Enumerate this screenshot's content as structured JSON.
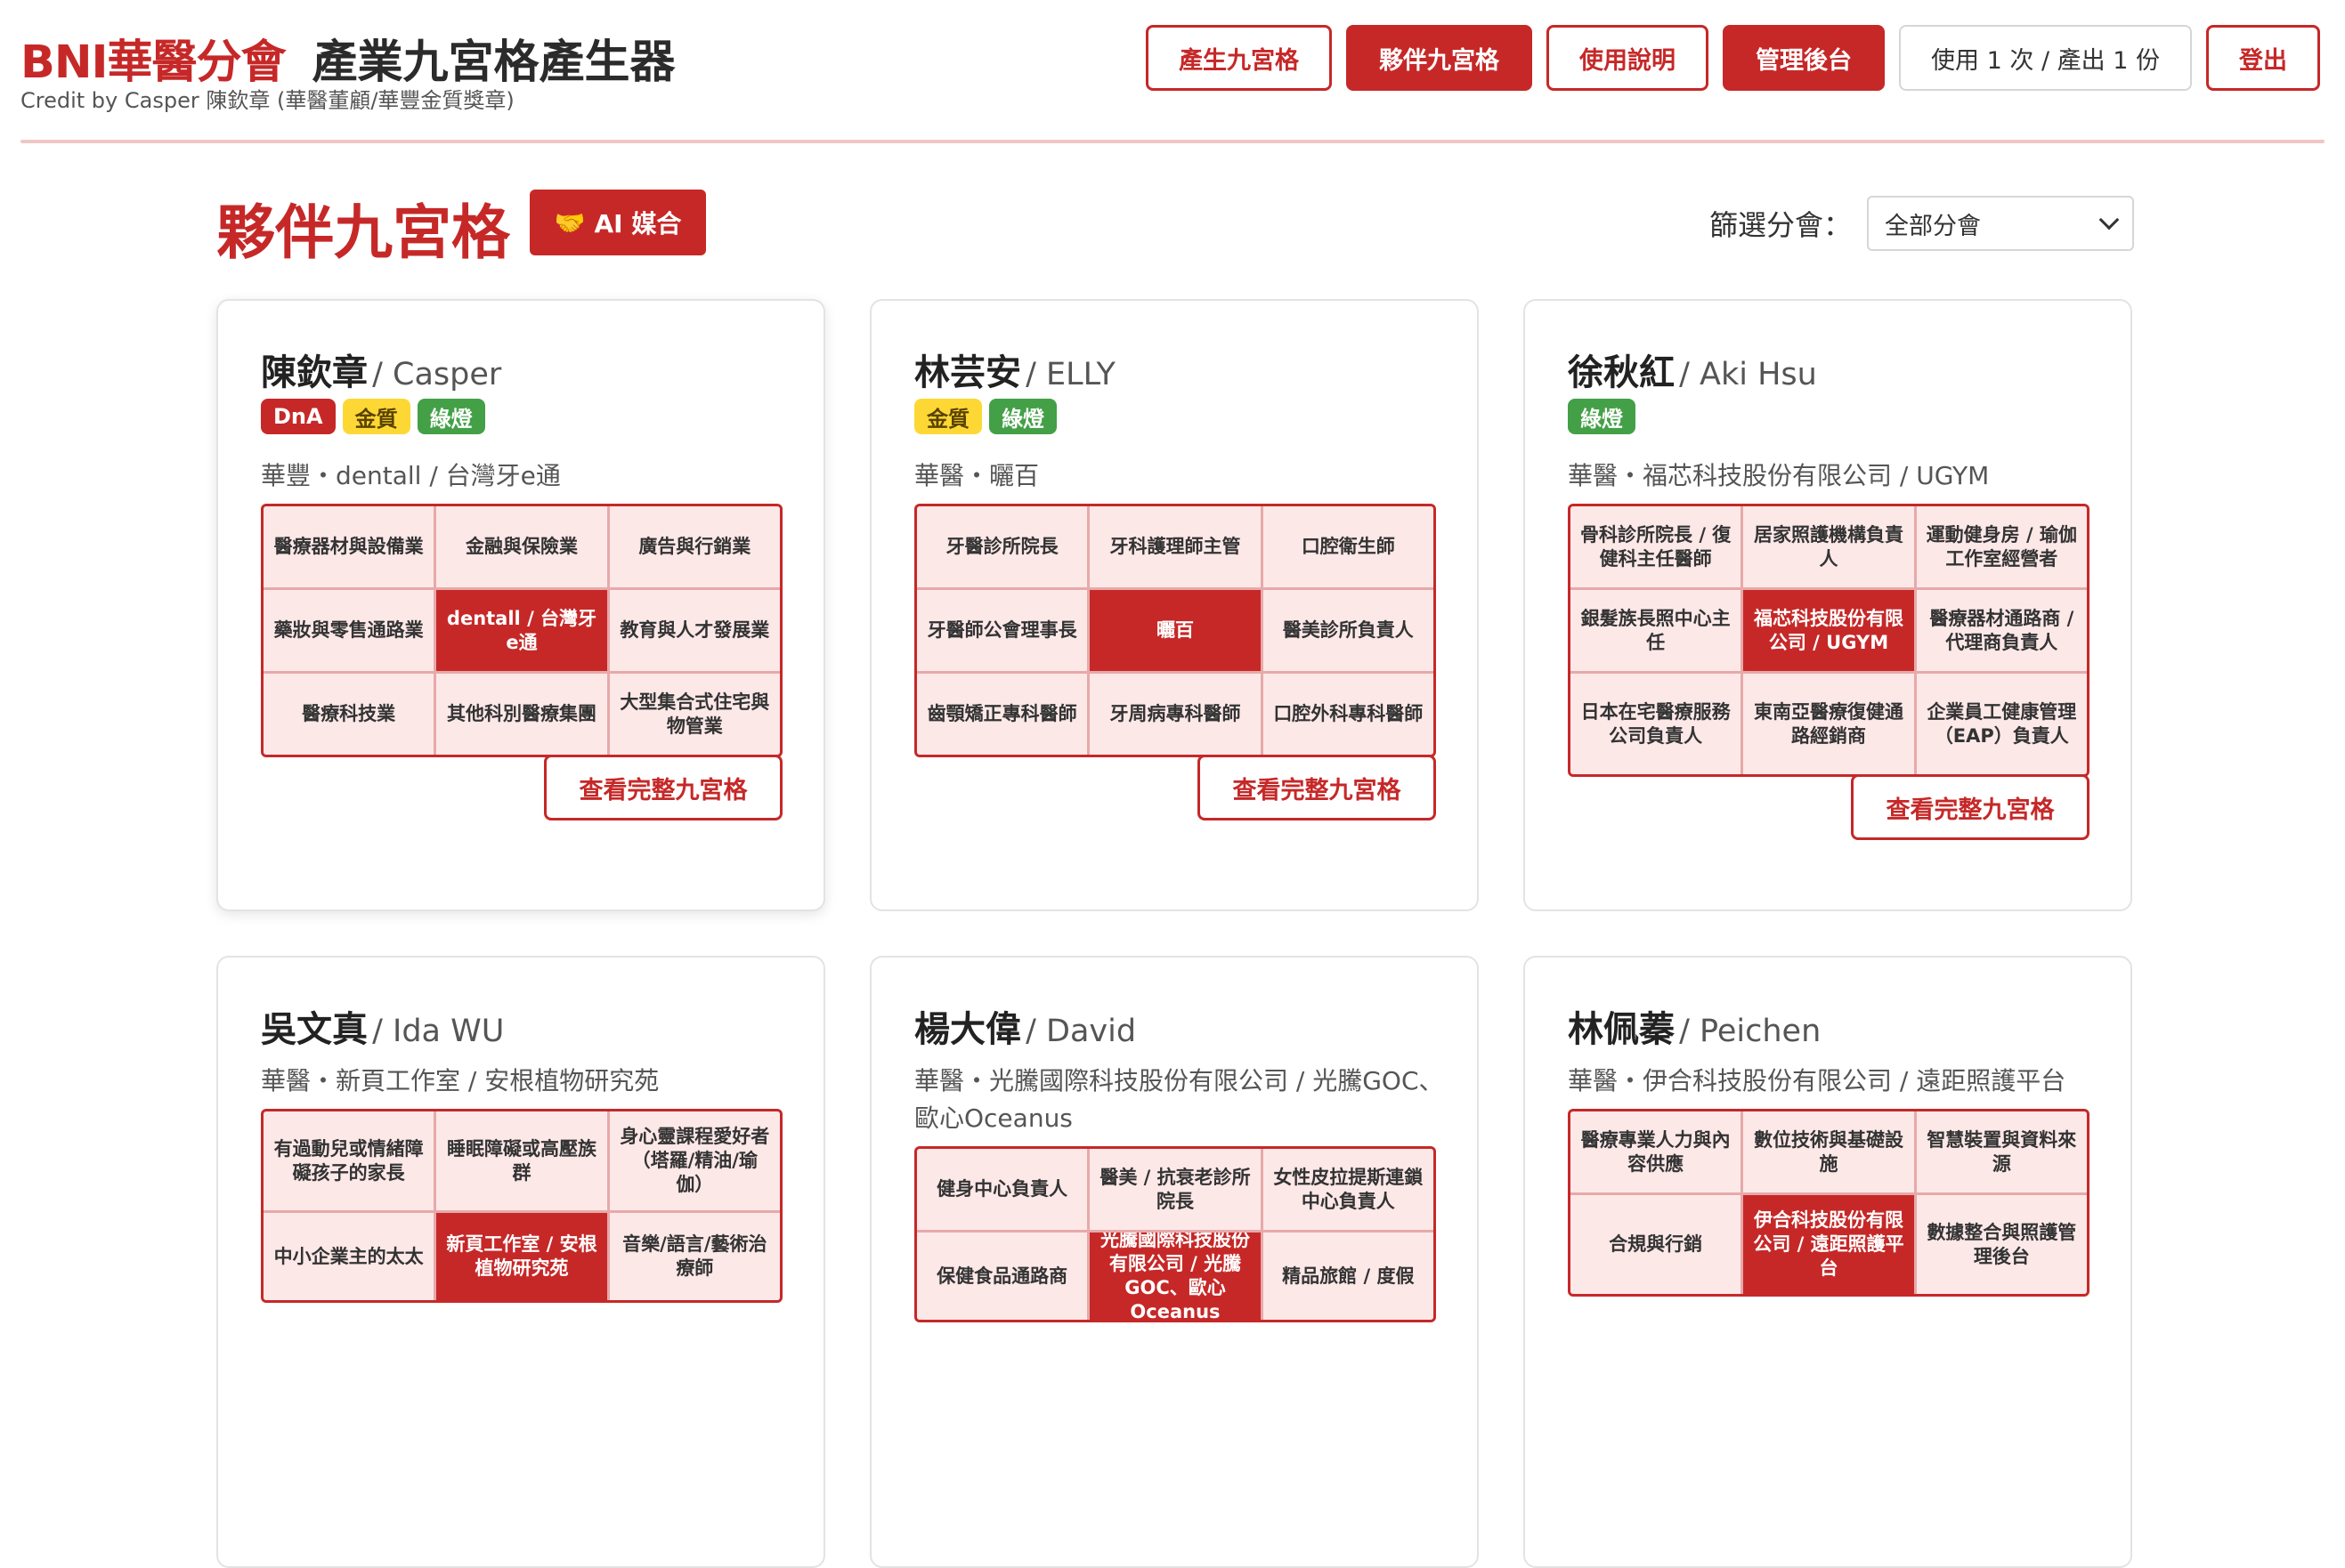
{
  "header": {
    "brand": "BNI華醫分會",
    "title": "產業九宮格產生器",
    "credit": "Credit by Casper 陳欽章 (華醫董顧/華豐金質獎章)",
    "nav": [
      {
        "label": "產生九宮格"
      },
      {
        "label": "夥伴九宮格"
      },
      {
        "label": "使用說明"
      },
      {
        "label": "管理後台"
      },
      {
        "label": "使用 1 次 / 產出 1 份"
      },
      {
        "label": "登出"
      }
    ]
  },
  "section": {
    "title": "夥伴九宮格",
    "ai_button": "AI 媒合",
    "ai_icon": "🤝",
    "filter_label": "篩選分會：",
    "filter_value": "全部分會"
  },
  "view_label": "查看完整九宮格",
  "cards": [
    {
      "name_zh": "陳欽章",
      "name_en": "/ Casper",
      "badges": [
        "DnA",
        "金質",
        "綠燈"
      ],
      "affiliation": "華豐・dentall / 台灣牙e通",
      "grid": [
        "醫療器材與設備業",
        "金融與保險業",
        "廣告與行銷業",
        "藥妝與零售通路業",
        "dentall / 台灣牙e通",
        "教育與人才發展業",
        "醫療科技業",
        "其他科別醫療集團",
        "大型集合式住宅與物管業"
      ]
    },
    {
      "name_zh": "林芸安",
      "name_en": "/ ELLY",
      "badges": [
        "金質",
        "綠燈"
      ],
      "affiliation": "華醫・曬百",
      "grid": [
        "牙醫診所院長",
        "牙科護理師主管",
        "口腔衛生師",
        "牙醫師公會理事長",
        "曬百",
        "醫美診所負責人",
        "齒顎矯正專科醫師",
        "牙周病專科醫師",
        "口腔外科專科醫師"
      ]
    },
    {
      "name_zh": "徐秋紅",
      "name_en": "/ Aki Hsu",
      "badges": [
        "綠燈"
      ],
      "affiliation": "華醫・福芯科技股份有限公司 / UGYM",
      "grid": [
        "骨科診所院長 / 復健科主任醫師",
        "居家照護機構負責人",
        "運動健身房 / 瑜伽工作室經營者",
        "銀髮族長照中心主任",
        "福芯科技股份有限公司 / UGYM",
        "醫療器材通路商 / 代理商負責人",
        "日本在宅醫療服務公司負責人",
        "東南亞醫療復健通路經銷商",
        "企業員工健康管理（EAP）負責人"
      ]
    },
    {
      "name_zh": "吳文真",
      "name_en": "/ Ida WU",
      "badges": [],
      "affiliation": "華醫・新頁工作室 / 安根植物研究苑",
      "grid": [
        "有過動兒或情緒障礙孩子的家長",
        "睡眠障礙或高壓族群",
        "身心靈課程愛好者（塔羅/精油/瑜伽）",
        "中小企業主的太太",
        "新頁工作室 / 安根植物研究苑",
        "音樂/語言/藝術治療師"
      ]
    },
    {
      "name_zh": "楊大偉",
      "name_en": "/ David",
      "badges": [],
      "affiliation": "華醫・光騰國際科技股份有限公司 / 光騰GOC、歐心Oceanus",
      "grid": [
        "健身中心負責人",
        "醫美 / 抗衰老診所院長",
        "女性皮拉提斯連鎖中心負責人",
        "保健食品通路商",
        "光騰國際科技股份有限公司 / 光騰GOC、歐心Oceanus",
        "精品旅館 / 度假"
      ]
    },
    {
      "name_zh": "林佩蓁",
      "name_en": "/ Peichen",
      "badges": [],
      "affiliation": "華醫・伊合科技股份有限公司 / 遠距照護平台",
      "grid": [
        "醫療專業人力與內容供應",
        "數位技術與基礎設施",
        "智慧裝置與資料來源",
        "合規與行銷",
        "伊合科技股份有限公司 / 遠距照護平台",
        "數據整合與照護管理後台"
      ]
    }
  ]
}
